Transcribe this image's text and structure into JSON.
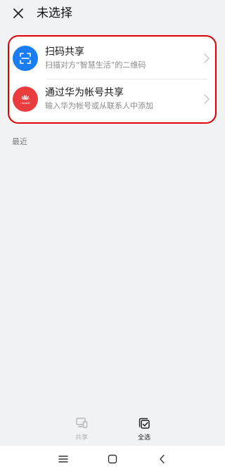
{
  "header": {
    "title": "未选择"
  },
  "share_options": [
    {
      "title": "扫码共享",
      "subtitle": "扫描对方“智慧生活”的二维码",
      "icon": "qr-scan-icon"
    },
    {
      "title": "通过华为帐号共享",
      "subtitle": "输入华为帐号或从联系人中添加",
      "icon": "huawei-logo-icon",
      "icon_text": "HUAWEI"
    }
  ],
  "recent_label": "最近",
  "bottom_tabs": [
    {
      "label": "共享",
      "icon": "share-devices-icon",
      "enabled": false
    },
    {
      "label": "全选",
      "icon": "select-all-icon",
      "enabled": true
    }
  ],
  "colors": {
    "background": "#f1f2f4",
    "scan_icon_bg": "#1a7df2",
    "huawei_icon_bg": "#ea3c3c",
    "highlight_border": "#e00000"
  }
}
